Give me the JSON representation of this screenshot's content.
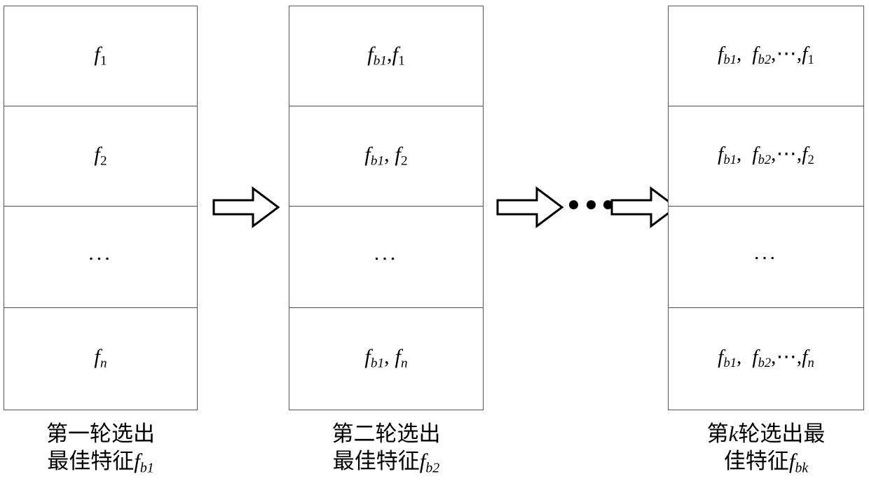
{
  "diagram": {
    "title": "Iterative best-feature selection rounds",
    "stroke_color": "#575757",
    "text_color": "#000000",
    "background_color": "#ffffff"
  },
  "columns": [
    {
      "name": "round-1-feature-list",
      "rows": [
        {
          "kind": "feature",
          "text": "f1",
          "base": "f",
          "sub": "1"
        },
        {
          "kind": "feature",
          "text": "f2",
          "base": "f",
          "sub": "2"
        },
        {
          "kind": "ellipsis",
          "text": "..."
        },
        {
          "kind": "feature",
          "text": "fn",
          "base": "f",
          "sub": "n"
        }
      ],
      "caption": {
        "line1": "第一轮选出",
        "line2_prefix": "最佳特征",
        "line2_math_base": "f",
        "line2_math_sub": "b1"
      }
    },
    {
      "name": "round-2-feature-list",
      "rows": [
        {
          "kind": "feature-pair",
          "text": "fb1,f1",
          "first_base": "f",
          "first_sub": "b1",
          "second_base": "f",
          "second_sub": "1"
        },
        {
          "kind": "feature-pair",
          "text": "fb1, f2",
          "first_base": "f",
          "first_sub": "b1",
          "second_base": "f",
          "second_sub": "2"
        },
        {
          "kind": "ellipsis",
          "text": "..."
        },
        {
          "kind": "feature-pair",
          "text": "fb1, fn",
          "first_base": "f",
          "first_sub": "b1",
          "second_base": "f",
          "second_sub": "n"
        }
      ],
      "caption": {
        "line1": "第二轮选出",
        "line2_prefix": "最佳特征",
        "line2_math_base": "f",
        "line2_math_sub": "b2"
      }
    },
    {
      "name": "round-k-feature-list",
      "rows": [
        {
          "kind": "feature-series",
          "text": "fb1, fb2, ⋯, f1",
          "first_base": "f",
          "first_sub": "b1",
          "second_base": "f",
          "second_sub": "b2",
          "dots": "⋯",
          "last_base": "f",
          "last_sub": "1"
        },
        {
          "kind": "feature-series",
          "text": "fb1, fb2, ⋯, f2",
          "first_base": "f",
          "first_sub": "b1",
          "second_base": "f",
          "second_sub": "b2",
          "dots": "⋯",
          "last_base": "f",
          "last_sub": "2"
        },
        {
          "kind": "ellipsis",
          "text": "..."
        },
        {
          "kind": "feature-series",
          "text": "fb1, fb2, ⋯, fn",
          "first_base": "f",
          "first_sub": "b1",
          "second_base": "f",
          "second_sub": "b2",
          "dots": "⋯",
          "last_base": "f",
          "last_sub": "n"
        }
      ],
      "caption": {
        "line1_prefix": "第",
        "line1_math": "k",
        "line1_suffix": "轮选出最",
        "line2_prefix": "佳特征",
        "line2_math_base": "f",
        "line2_math_sub": "bk"
      }
    }
  ],
  "connectors": [
    {
      "name": "arrow-round1-to-round2",
      "kind": "block-arrow-right"
    },
    {
      "name": "arrow-round2-to-intermediate",
      "kind": "block-arrow-right"
    },
    {
      "name": "ellipsis-between-arrows",
      "kind": "dots",
      "count": 3,
      "text": "•••"
    },
    {
      "name": "arrow-intermediate-to-roundk",
      "kind": "block-arrow-right"
    }
  ]
}
